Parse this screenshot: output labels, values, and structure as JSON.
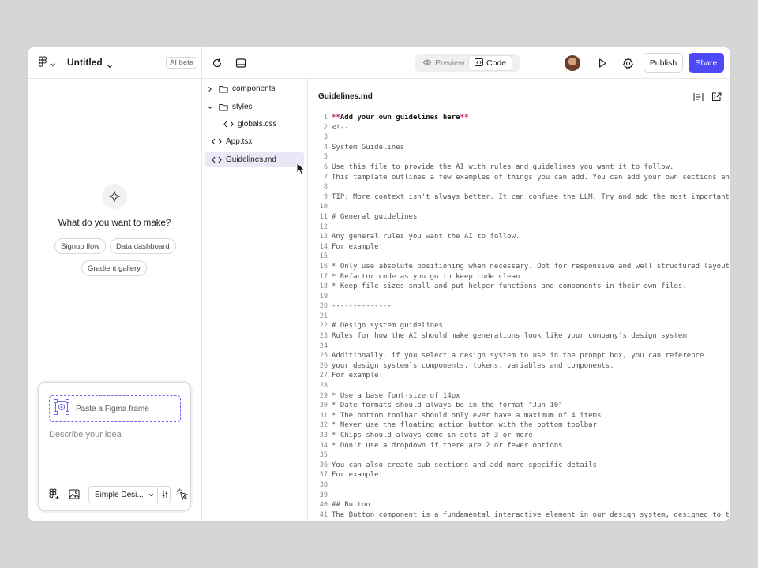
{
  "header": {
    "title": "Untitled",
    "ai_badge": "AI beta",
    "preview_label": "Preview",
    "code_label": "Code",
    "publish_label": "Publish",
    "share_label": "Share"
  },
  "left": {
    "prompt_title": "What do you want to make?",
    "suggestions": [
      "Signup flow",
      "Data dashboard",
      "Gradient gallery"
    ],
    "paste_frame_label": "Paste a Figma frame",
    "describe_placeholder": "Describe your idea",
    "style_select": "Simple Desi..."
  },
  "tree": {
    "items": [
      {
        "label": "components",
        "type": "folder",
        "expanded": false
      },
      {
        "label": "styles",
        "type": "folder",
        "expanded": true
      },
      {
        "label": "globals.css",
        "type": "file"
      },
      {
        "label": "App.tsx",
        "type": "file"
      },
      {
        "label": "Guidelines.md",
        "type": "file",
        "selected": true
      }
    ]
  },
  "editor": {
    "tab_label": "Guidelines.md",
    "lines": [
      {
        "n": "1",
        "t": "Add your own guidelines here"
      },
      {
        "n": "2",
        "t": "<!--"
      },
      {
        "n": "3",
        "t": ""
      },
      {
        "n": "4",
        "t": "System Guidelines"
      },
      {
        "n": "5",
        "t": ""
      },
      {
        "n": "6",
        "t": "Use this file to provide the AI with rules and guidelines you want it to follow."
      },
      {
        "n": "7",
        "t": "This template outlines a few examples of things you can add. You can add your own sections and"
      },
      {
        "n": "8",
        "t": ""
      },
      {
        "n": "9",
        "t": "TIP: More context isn't always better. It can confuse the LLM. Try and add the most important"
      },
      {
        "n": "10",
        "t": ""
      },
      {
        "n": "11",
        "t": "# General guidelines"
      },
      {
        "n": "12",
        "t": ""
      },
      {
        "n": "13",
        "t": "Any general rules you want the AI to follow."
      },
      {
        "n": "14",
        "t": "For example:"
      },
      {
        "n": "15",
        "t": ""
      },
      {
        "n": "16",
        "t": "* Only use absolute positioning when necessary. Opt for responsive and well structured layouts"
      },
      {
        "n": "17",
        "t": "* Refactor code as you go to keep code clean"
      },
      {
        "n": "18",
        "t": "* Keep file sizes small and put helper functions and components in their own files."
      },
      {
        "n": "19",
        "t": ""
      },
      {
        "n": "20",
        "t": "--------------"
      },
      {
        "n": "21",
        "t": ""
      },
      {
        "n": "22",
        "t": "# Design system guidelines"
      },
      {
        "n": "23",
        "t": "Rules for how the AI should make generations look like your company's design system"
      },
      {
        "n": "24",
        "t": ""
      },
      {
        "n": "25",
        "t": "Additionally, if you select a design system to use in the prompt box, you can reference"
      },
      {
        "n": "26",
        "t": "your design system`s components, tokens, variables and components."
      },
      {
        "n": "27",
        "t": "For example:"
      },
      {
        "n": "28",
        "t": ""
      },
      {
        "n": "29",
        "t": "* Use a base font-size of 14px"
      },
      {
        "n": "30",
        "t": "* Date formats should always be in the format \"Jun 10\""
      },
      {
        "n": "31",
        "t": "* The bottom toolbar should only ever have a maximum of 4 items"
      },
      {
        "n": "32",
        "t": "* Never use the floating action button with the bottom toolbar"
      },
      {
        "n": "33",
        "t": "* Chips should always come in sets of 3 or more"
      },
      {
        "n": "34",
        "t": "* Don't use a dropdown if there are 2 or fewer options"
      },
      {
        "n": "35",
        "t": ""
      },
      {
        "n": "36",
        "t": "You can also create sub sections and add more specific details"
      },
      {
        "n": "37",
        "t": "For example:"
      },
      {
        "n": "38",
        "t": ""
      },
      {
        "n": "39",
        "t": ""
      },
      {
        "n": "40",
        "t": "## Button"
      },
      {
        "n": "41",
        "t": "The Button component is a fundamental interactive element in our design system, designed to t"
      }
    ]
  },
  "colors": {
    "accent": "#4d49f6",
    "markdown_marker": "#c2187a",
    "selected_row": "#e8e8f6"
  }
}
